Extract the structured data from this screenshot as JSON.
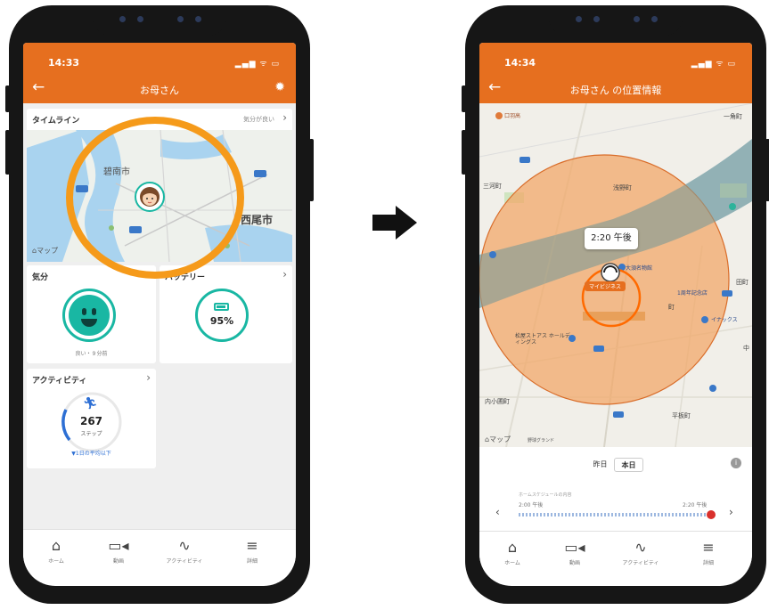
{
  "left_phone": {
    "status_time": "14:33",
    "status_icons": "▂▄▆ ᯤ ▭",
    "header_title": "お母さん",
    "timeline": {
      "title": "タイムライン",
      "sub": "気分が良い",
      "map_label": "マップ",
      "city1": "碧南市",
      "city2": "西尾市"
    },
    "mood": {
      "title": "気分",
      "caption": "良い・９分前"
    },
    "battery": {
      "title": "バッテリー",
      "value": "95%"
    },
    "activity": {
      "title": "アクティビティ",
      "steps": "267",
      "unit": "ステップ",
      "caption": "▼1日の平均以下"
    },
    "tabs": [
      "ホーム",
      "動画",
      "アクティビティ",
      "詳細"
    ]
  },
  "right_phone": {
    "status_time": "14:34",
    "status_icons": "▂▄▆ ᯤ ▭",
    "header_title": "お母さん の位置情報",
    "bubble": "2:20 午後",
    "place_tag": "マイビジネス",
    "map_labels": {
      "top_left": "口羽高",
      "top_right": "一角町",
      "left_mid": "三河町",
      "upper": "浅野町",
      "right_station": "大須名物館",
      "right_mid": "1周年記念店",
      "right_mid2": "田町",
      "right_mid3": "町",
      "right_park": "イナックス",
      "lower_left": "松屋ストアス ホールディングス",
      "bottom_left": "内小圃町",
      "bottom_right": "平板町",
      "right_edge": "中",
      "bottom_map": "マップ",
      "bottom_map2": "野球グランド"
    },
    "day_toggle": [
      "昨日",
      "本日"
    ],
    "slider": {
      "caption": "ホームスケジュールの内容",
      "start": "2:00 午後",
      "end": "2:20 午後"
    },
    "tabs": [
      "ホーム",
      "動画",
      "アクティビティ",
      "詳細"
    ]
  },
  "colors": {
    "accent": "#e66f1f",
    "highlight_ring": "#f59a1a",
    "teal": "#19b7a3",
    "radius_fill": "#f2a86a"
  }
}
